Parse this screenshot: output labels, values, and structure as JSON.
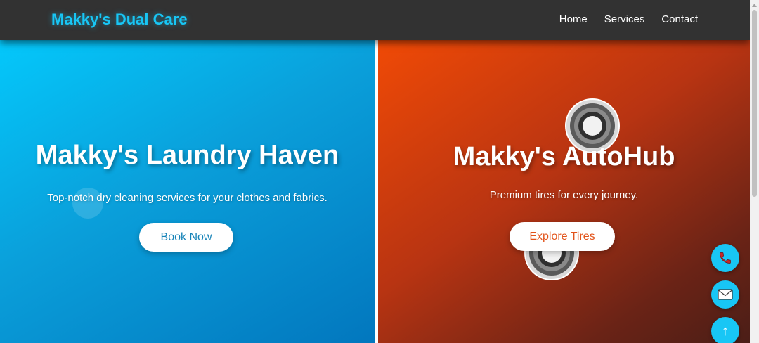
{
  "nav": {
    "brand": "Makky's Dual Care",
    "links": [
      "Home",
      "Services",
      "Contact"
    ]
  },
  "laundry": {
    "title": "Makky's Laundry Haven",
    "subtitle": "Top-notch dry cleaning services for your clothes and fabrics.",
    "button": "Book Now"
  },
  "auto": {
    "title": "Makky's AutoHub",
    "subtitle": "Premium tires for every journey.",
    "button": "Explore Tires"
  },
  "floating": {
    "phone_icon": "phone-icon",
    "mail_icon": "mail-icon",
    "top_icon": "arrow-up-icon",
    "top_symbol": "↑"
  },
  "colors": {
    "accent": "#18c6f5",
    "navbar": "#323232",
    "laundry_start": "#04c8fb",
    "laundry_end": "#0277be",
    "auto_start": "#f04a06",
    "auto_end": "#4b1e17",
    "auto_button_text": "#e2531a"
  }
}
